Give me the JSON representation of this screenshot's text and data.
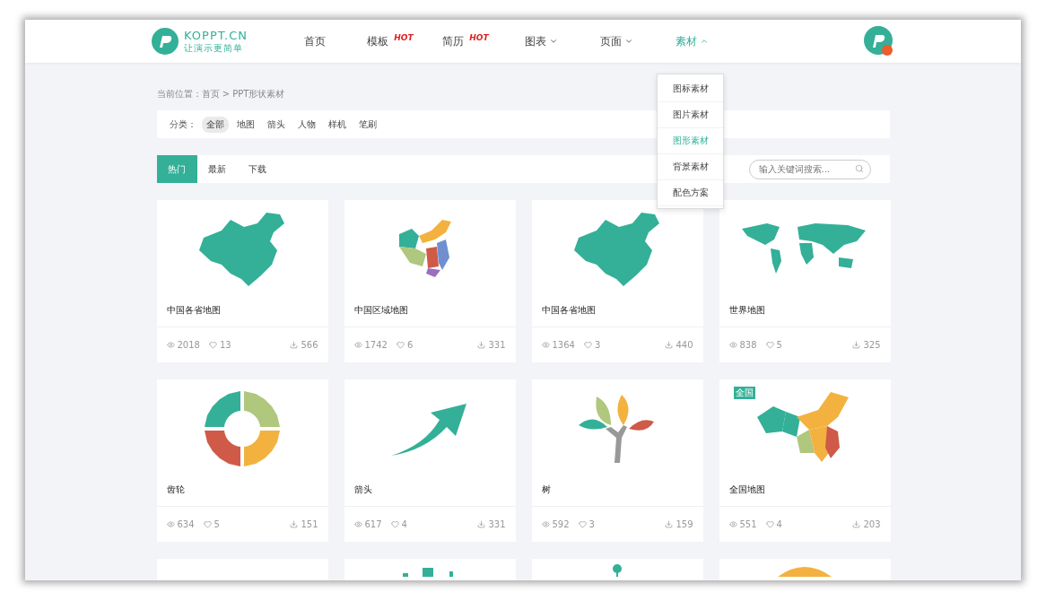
{
  "logo": {
    "name": "KOPPT.CN",
    "slogan": "让演示更简单"
  },
  "nav": [
    {
      "label": "首页",
      "selected": false
    },
    {
      "label": "模板",
      "badge": "HOT",
      "selected": false
    },
    {
      "label": "简历",
      "badge": "HOT",
      "selected": false
    },
    {
      "label": "图表",
      "expanded": false,
      "selected": false
    },
    {
      "label": "页面",
      "expanded": false,
      "selected": false
    },
    {
      "label": "素材",
      "expanded": true,
      "selected": true
    }
  ],
  "dropdown": [
    {
      "label": "图标素材",
      "selected": false
    },
    {
      "label": "图片素材",
      "selected": false
    },
    {
      "label": "图形素材",
      "selected": true
    },
    {
      "label": "背景素材",
      "selected": false
    },
    {
      "label": "配色方案",
      "selected": false
    }
  ],
  "breadcrumb": "当前位置：首页 > PPT形状素材",
  "filter": {
    "label": "分类：",
    "options": [
      {
        "label": "全部",
        "selected": true
      },
      {
        "label": "地图",
        "selected": false
      },
      {
        "label": "箭头",
        "selected": false
      },
      {
        "label": "人物",
        "selected": false
      },
      {
        "label": "样机",
        "selected": false
      },
      {
        "label": "笔刷",
        "selected": false
      }
    ]
  },
  "sort_tabs": [
    {
      "label": "热门",
      "selected": true
    },
    {
      "label": "最新",
      "selected": false
    },
    {
      "label": "下载",
      "selected": false
    }
  ],
  "search": {
    "placeholder": "输入关键词搜索..."
  },
  "cards": [
    {
      "kind": "china",
      "title": "中国各省地图",
      "views": "2018",
      "likes": "13",
      "downloads": "566"
    },
    {
      "kind": "regions",
      "title": "中国区域地图",
      "views": "1742",
      "likes": "6",
      "downloads": "331"
    },
    {
      "kind": "china",
      "title": "中国各省地图",
      "views": "1364",
      "likes": "3",
      "downloads": "440"
    },
    {
      "kind": "world",
      "title": "世界地图",
      "views": "838",
      "likes": "5",
      "downloads": "325"
    },
    {
      "kind": "gear",
      "title": "齿轮",
      "views": "634",
      "likes": "5",
      "downloads": "151"
    },
    {
      "kind": "arrow",
      "title": "箭头",
      "views": "617",
      "likes": "4",
      "downloads": "331"
    },
    {
      "kind": "tree",
      "title": "树",
      "views": "592",
      "likes": "3",
      "downloads": "159"
    },
    {
      "kind": "colormap",
      "title": "全国地图",
      "tag": "全国",
      "views": "551",
      "likes": "4",
      "downloads": "203"
    }
  ],
  "partial_cards": [
    {
      "kind": "blank"
    },
    {
      "kind": "skyline"
    },
    {
      "kind": "pin"
    },
    {
      "kind": "circle"
    }
  ]
}
